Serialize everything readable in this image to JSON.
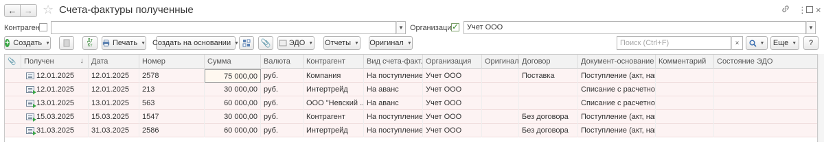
{
  "header": {
    "back_icon": "arrow-left",
    "forward_icon": "arrow-right",
    "title": "Счета-фактуры полученные",
    "link_icon": "link",
    "menu_icon": "more-vertical",
    "maximize_icon": "maximize",
    "close_icon": "close"
  },
  "filters": {
    "counterparty_label": "Контрагент:",
    "counterparty_value": "",
    "organization_label": "Организация:",
    "organization_checked": true,
    "organization_value": "Учет ООО"
  },
  "toolbar": {
    "create": "Создать",
    "print": "Печать",
    "create_based_on": "Создать на основании",
    "edo": "ЭДО",
    "reports": "Отчеты",
    "original": "Оригинал",
    "search_placeholder": "Поиск (Ctrl+F)",
    "more": "Еще",
    "help": "?"
  },
  "table": {
    "columns": [
      "Получен",
      "Дата",
      "Номер",
      "Сумма",
      "Валюта",
      "Контрагент",
      "Вид счета-факт...",
      "Организация",
      "Оригинал",
      "Договор",
      "Документ-основание",
      "Комментарий",
      "Состояние ЭДО"
    ],
    "rows": [
      {
        "received": "12.01.2025",
        "date": "12.01.2025",
        "number": "2578",
        "sum": "75 000,00",
        "currency": "руб.",
        "counterparty": "Компания",
        "kind": "На поступление",
        "org": "Учет ООО",
        "original": "",
        "contract": "Поставка",
        "base_doc": "Поступление (акт, нак...",
        "comment": "",
        "edo": ""
      },
      {
        "received": "12.01.2025",
        "date": "12.01.2025",
        "number": "213",
        "sum": "30 000,00",
        "currency": "руб.",
        "counterparty": "Интертрейд",
        "kind": "На аванс",
        "org": "Учет ООО",
        "original": "",
        "contract": "",
        "base_doc": "Списание с расчетног...",
        "comment": "",
        "edo": ""
      },
      {
        "received": "13.01.2025",
        "date": "13.01.2025",
        "number": "563",
        "sum": "60 000,00",
        "currency": "руб.",
        "counterparty": "ООО \"Невский ...",
        "kind": "На аванс",
        "org": "Учет ООО",
        "original": "",
        "contract": "",
        "base_doc": "Списание с расчетног...",
        "comment": "",
        "edo": ""
      },
      {
        "received": "15.03.2025",
        "date": "15.03.2025",
        "number": "1547",
        "sum": "30 000,00",
        "currency": "руб.",
        "counterparty": "Контрагент",
        "kind": "На поступление",
        "org": "Учет ООО",
        "original": "",
        "contract": "Без договора",
        "base_doc": "Поступление (акт, нак...",
        "comment": "",
        "edo": ""
      },
      {
        "received": "31.03.2025",
        "date": "31.03.2025",
        "number": "2586",
        "sum": "60 000,00",
        "currency": "руб.",
        "counterparty": "Интертрейд",
        "kind": "На поступление",
        "org": "Учет ООО",
        "original": "",
        "contract": "Без договора",
        "base_doc": "Поступление (акт, нак...",
        "comment": "",
        "edo": ""
      }
    ]
  }
}
